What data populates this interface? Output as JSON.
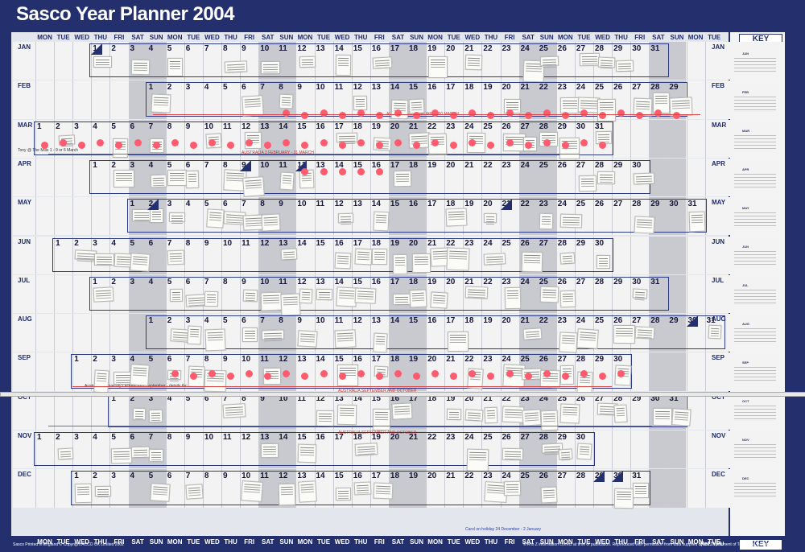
{
  "title": "Sasco Year Planner 2004",
  "day_headers": [
    "MON",
    "TUE",
    "WED",
    "THU",
    "FRI",
    "SAT",
    "SUN",
    "MON",
    "TUE",
    "WED",
    "THU",
    "FRI",
    "SAT",
    "SUN",
    "MON",
    "TUE",
    "WED",
    "THU",
    "FRI",
    "SAT",
    "SUN",
    "MON",
    "TUE",
    "WED",
    "THU",
    "FRI",
    "SAT",
    "SUN",
    "MON",
    "TUE",
    "WED",
    "THU",
    "FRI",
    "SAT",
    "SUN",
    "MON",
    "TUE"
  ],
  "months": [
    {
      "name": "JAN",
      "start": 3,
      "days": 31
    },
    {
      "name": "FEB",
      "start": 6,
      "days": 29
    },
    {
      "name": "MAR",
      "start": 0,
      "days": 31
    },
    {
      "name": "APR",
      "start": 3,
      "days": 30
    },
    {
      "name": "MAY",
      "start": 5,
      "days": 31
    },
    {
      "name": "JUN",
      "start": 1,
      "days": 30
    },
    {
      "name": "JUL",
      "start": 3,
      "days": 31
    },
    {
      "name": "AUG",
      "start": 6,
      "days": 31
    },
    {
      "name": "SEP",
      "start": 2,
      "days": 30
    },
    {
      "name": "OCT",
      "start": 4,
      "days": 31
    },
    {
      "name": "NOV",
      "start": 0,
      "days": 30
    },
    {
      "name": "DEC",
      "start": 2,
      "days": 31
    }
  ],
  "key_label": "KEY",
  "annotations": {
    "feb_band": "AUSTRALIA 3 FEBRUARY - 30 MARCH",
    "mar_band": "AUSTRALIA 3 FEBRUARY - 31 MARCH",
    "mar_note": "Tony @ The Mills 1 - 9 or 6 March",
    "sep_note": "Australian University Lecture Tour September - details tbc",
    "sep_band": "AUSTRALIA SEPTEMBER AND OCTOBER",
    "oct_band": "AUSTRALIA SEPTEMBER AND OCTOBER",
    "dec_note": "Carol on holiday 24 December - 2 January"
  },
  "footer": {
    "left": "Sasco Printed in England © Copyright ACCO UK Limited 2002",
    "mid": "© A to Z information correct at time of publication. Reproduced with permission from data supplied by the Department of Trade and Industry.",
    "ref": "Ref. YPU"
  },
  "colors": {
    "frame": "#24306e",
    "dot": "#ff5b6e",
    "weekend": "#c9cacf"
  }
}
